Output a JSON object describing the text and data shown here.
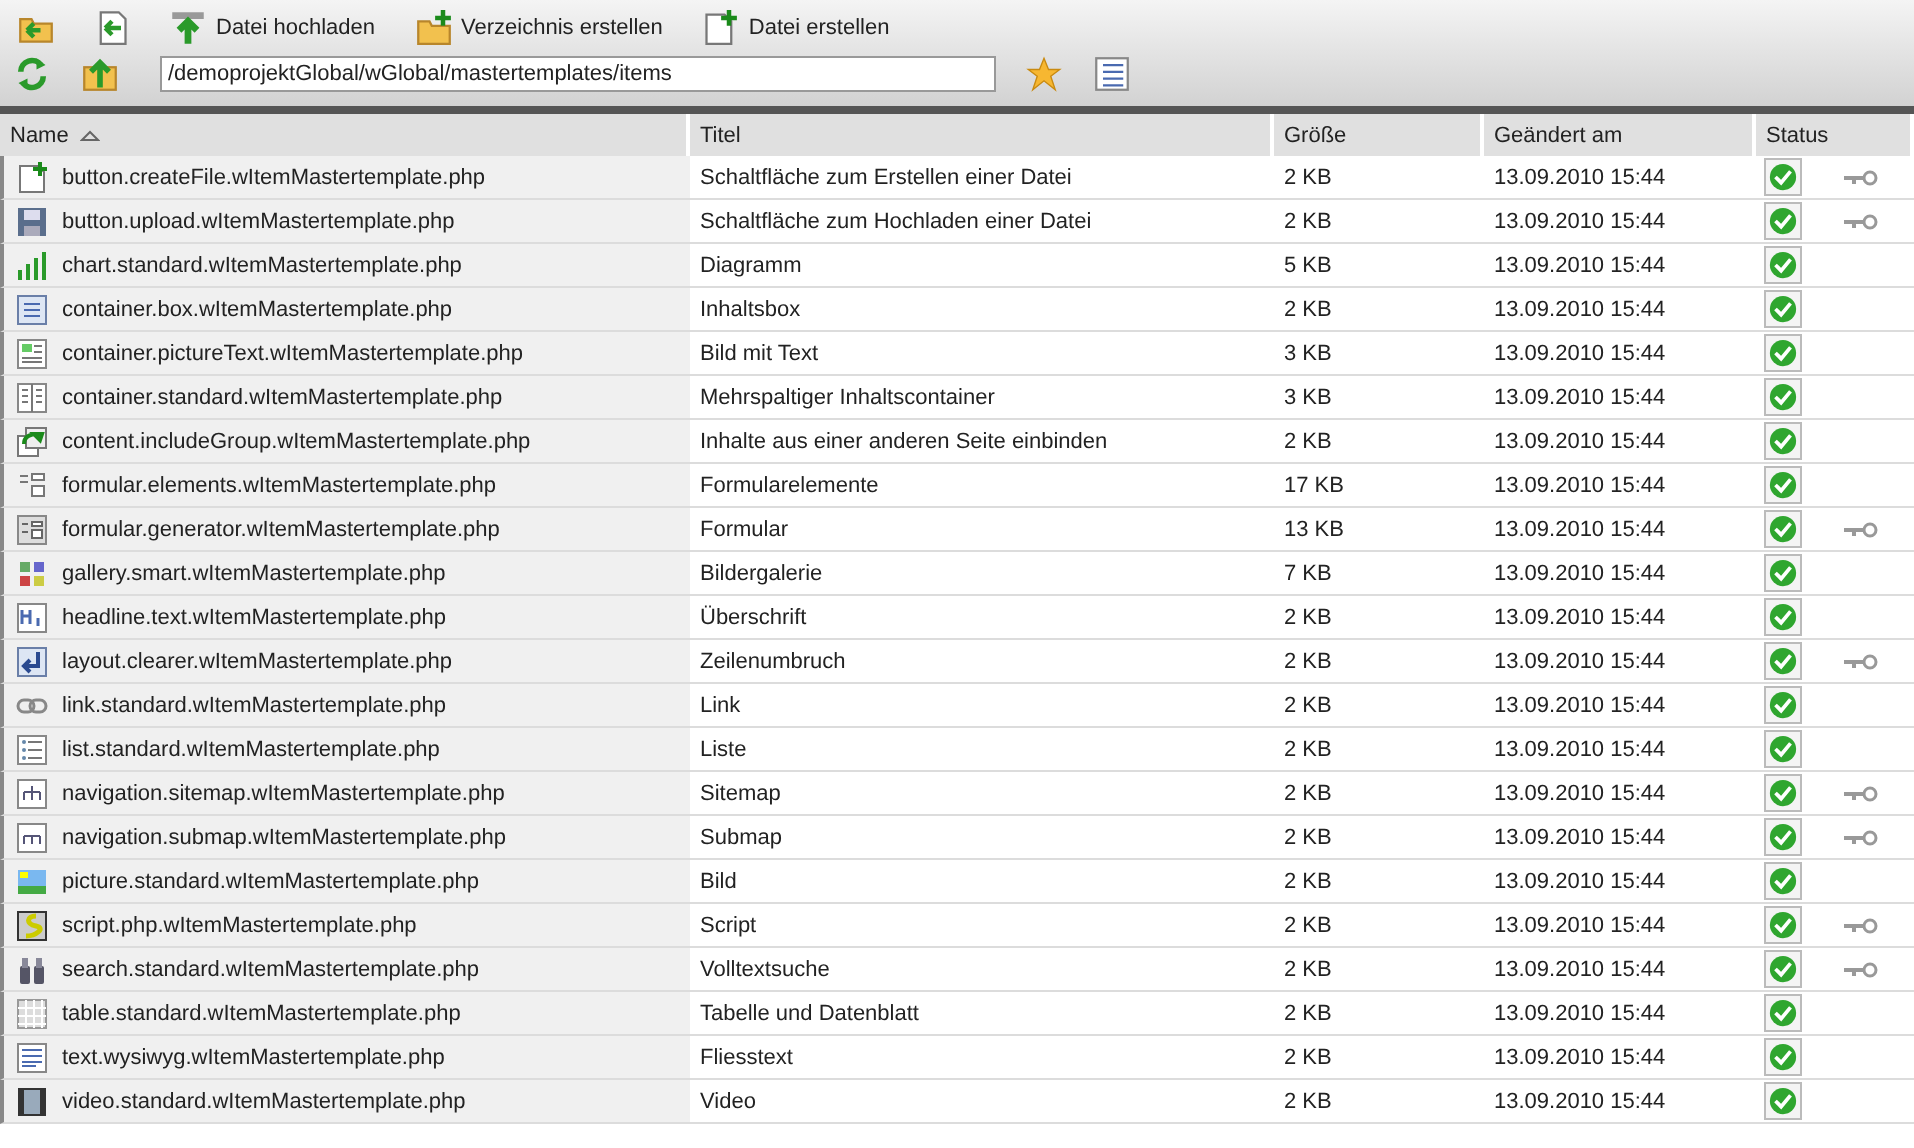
{
  "toolbar": {
    "buttons": [
      {
        "kind": "folder-back"
      },
      {
        "kind": "back"
      },
      {
        "kind": "upload",
        "label": "Datei hochladen"
      },
      {
        "kind": "new-folder",
        "label": "Verzeichnis erstellen"
      },
      {
        "kind": "new-file",
        "label": "Datei erstellen"
      }
    ]
  },
  "path_bar": {
    "path": "/demoprojektGlobal/wGlobal/mastertemplates/items"
  },
  "table": {
    "columns": [
      {
        "label": "Name",
        "sorted": true
      },
      {
        "label": "Titel",
        "sorted": false
      },
      {
        "label": "Größe",
        "sorted": false
      },
      {
        "label": "Geändert am",
        "sorted": false
      },
      {
        "label": "Status",
        "sorted": false
      }
    ],
    "rows": [
      {
        "kind": "create-file",
        "name": "button.createFile.wItemMastertemplate.php",
        "title": "Schaltfläche zum Erstellen einer Datei",
        "size": "2 KB",
        "modified": "13.09.2010 15:44",
        "ok": true,
        "locked": true
      },
      {
        "kind": "disk",
        "name": "button.upload.wItemMastertemplate.php",
        "title": "Schaltfläche zum Hochladen einer Datei",
        "size": "2 KB",
        "modified": "13.09.2010 15:44",
        "ok": true,
        "locked": true
      },
      {
        "kind": "chart",
        "name": "chart.standard.wItemMastertemplate.php",
        "title": "Diagramm",
        "size": "5 KB",
        "modified": "13.09.2010 15:44",
        "ok": true,
        "locked": false
      },
      {
        "kind": "box",
        "name": "container.box.wItemMastertemplate.php",
        "title": "Inhaltsbox",
        "size": "2 KB",
        "modified": "13.09.2010 15:44",
        "ok": true,
        "locked": false
      },
      {
        "kind": "picture-text",
        "name": "container.pictureText.wItemMastertemplate.php",
        "title": "Bild mit Text",
        "size": "3 KB",
        "modified": "13.09.2010 15:44",
        "ok": true,
        "locked": false
      },
      {
        "kind": "columns",
        "name": "container.standard.wItemMastertemplate.php",
        "title": "Mehrspaltiger Inhaltscontainer",
        "size": "3 KB",
        "modified": "13.09.2010 15:44",
        "ok": true,
        "locked": false
      },
      {
        "kind": "include",
        "name": "content.includeGroup.wItemMastertemplate.php",
        "title": "Inhalte aus einer anderen Seite einbinden",
        "size": "2 KB",
        "modified": "13.09.2010 15:44",
        "ok": true,
        "locked": false
      },
      {
        "kind": "form-elements",
        "name": "formular.elements.wItemMastertemplate.php",
        "title": "Formularelemente",
        "size": "17 KB",
        "modified": "13.09.2010 15:44",
        "ok": true,
        "locked": false
      },
      {
        "kind": "form",
        "name": "formular.generator.wItemMastertemplate.php",
        "title": "Formular",
        "size": "13 KB",
        "modified": "13.09.2010 15:44",
        "ok": true,
        "locked": true
      },
      {
        "kind": "gallery",
        "name": "gallery.smart.wItemMastertemplate.php",
        "title": "Bildergalerie",
        "size": "7 KB",
        "modified": "13.09.2010 15:44",
        "ok": true,
        "locked": false
      },
      {
        "kind": "headline",
        "name": "headline.text.wItemMastertemplate.php",
        "title": "Überschrift",
        "size": "2 KB",
        "modified": "13.09.2010 15:44",
        "ok": true,
        "locked": false
      },
      {
        "kind": "clearer",
        "name": "layout.clearer.wItemMastertemplate.php",
        "title": "Zeilenumbruch",
        "size": "2 KB",
        "modified": "13.09.2010 15:44",
        "ok": true,
        "locked": true
      },
      {
        "kind": "link",
        "name": "link.standard.wItemMastertemplate.php",
        "title": "Link",
        "size": "2 KB",
        "modified": "13.09.2010 15:44",
        "ok": true,
        "locked": false
      },
      {
        "kind": "list",
        "name": "list.standard.wItemMastertemplate.php",
        "title": "Liste",
        "size": "2 KB",
        "modified": "13.09.2010 15:44",
        "ok": true,
        "locked": false
      },
      {
        "kind": "sitemap",
        "name": "navigation.sitemap.wItemMastertemplate.php",
        "title": "Sitemap",
        "size": "2 KB",
        "modified": "13.09.2010 15:44",
        "ok": true,
        "locked": true
      },
      {
        "kind": "submap",
        "name": "navigation.submap.wItemMastertemplate.php",
        "title": "Submap",
        "size": "2 KB",
        "modified": "13.09.2010 15:44",
        "ok": true,
        "locked": true
      },
      {
        "kind": "picture",
        "name": "picture.standard.wItemMastertemplate.php",
        "title": "Bild",
        "size": "2 KB",
        "modified": "13.09.2010 15:44",
        "ok": true,
        "locked": false
      },
      {
        "kind": "script",
        "name": "script.php.wItemMastertemplate.php",
        "title": "Script",
        "size": "2 KB",
        "modified": "13.09.2010 15:44",
        "ok": true,
        "locked": true
      },
      {
        "kind": "binoculars",
        "name": "search.standard.wItemMastertemplate.php",
        "title": "Volltextsuche",
        "size": "2 KB",
        "modified": "13.09.2010 15:44",
        "ok": true,
        "locked": true
      },
      {
        "kind": "table",
        "name": "table.standard.wItemMastertemplate.php",
        "title": "Tabelle und Datenblatt",
        "size": "2 KB",
        "modified": "13.09.2010 15:44",
        "ok": true,
        "locked": false
      },
      {
        "kind": "text",
        "name": "text.wysiwyg.wItemMastertemplate.php",
        "title": "Fliesstext",
        "size": "2 KB",
        "modified": "13.09.2010 15:44",
        "ok": true,
        "locked": false
      },
      {
        "kind": "film",
        "name": "video.standard.wItemMastertemplate.php",
        "title": "Video",
        "size": "2 KB",
        "modified": "13.09.2010 15:44",
        "ok": true,
        "locked": false
      }
    ]
  }
}
